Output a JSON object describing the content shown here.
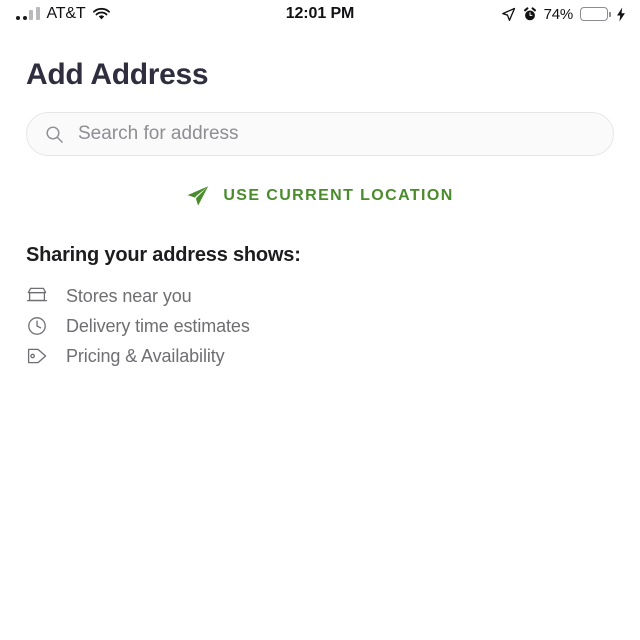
{
  "status_bar": {
    "carrier": "AT&T",
    "time": "12:01 PM",
    "battery_percent": "74%",
    "battery_level": 74,
    "icons": {
      "signal": "signal-bars-icon",
      "wifi": "wifi-icon",
      "location": "location-arrow-icon",
      "alarm": "alarm-clock-icon",
      "battery": "battery-icon",
      "charging": "lightning-bolt-icon"
    }
  },
  "page": {
    "title": "Add Address"
  },
  "search": {
    "placeholder": "Search for address",
    "value": "",
    "icon": "search-icon"
  },
  "use_current_location": {
    "label": "Use Current Location",
    "icon": "paper-plane-icon",
    "color": "#4a8b2c"
  },
  "benefits": {
    "heading": "Sharing your address shows:",
    "items": [
      {
        "label": "Stores near you",
        "icon": "storefront-icon"
      },
      {
        "label": "Delivery time estimates",
        "icon": "clock-icon"
      },
      {
        "label": "Pricing & Availability",
        "icon": "price-tag-icon"
      }
    ]
  },
  "colors": {
    "title": "#2e2e3f",
    "accent_green": "#4a8b2c",
    "body_text": "#6e6e73",
    "battery_fill": "#f5cf3d",
    "search_bg": "#fafafa",
    "search_border": "#e6e6e8"
  }
}
